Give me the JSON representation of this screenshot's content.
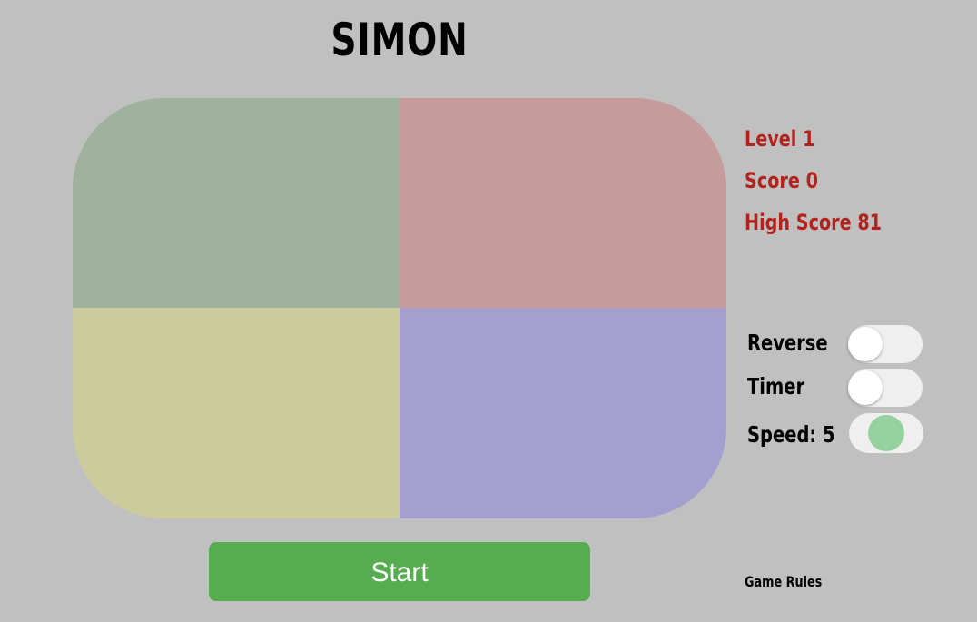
{
  "game": {
    "title": "SIMON"
  },
  "board": {
    "pads": [
      {
        "name": "green",
        "color": "#9fb29d"
      },
      {
        "name": "red",
        "color": "#c59b9c"
      },
      {
        "name": "yellow",
        "color": "#cccb9b"
      },
      {
        "name": "blue",
        "color": "#a59fcf"
      }
    ]
  },
  "stats": {
    "level": "Level 1",
    "score": "Score 0",
    "high_score": "High Score 81",
    "color": "#b3231e"
  },
  "options": {
    "reverse_label": "Reverse",
    "reverse_on": false,
    "timer_label": "Timer",
    "timer_on": false,
    "speed_label": "Speed: 5",
    "speed_value": 5,
    "speed_thumb_color": "#94d19f"
  },
  "controls": {
    "start_label": "Start",
    "start_color": "#56ad4f",
    "rules_label": "Game Rules"
  }
}
